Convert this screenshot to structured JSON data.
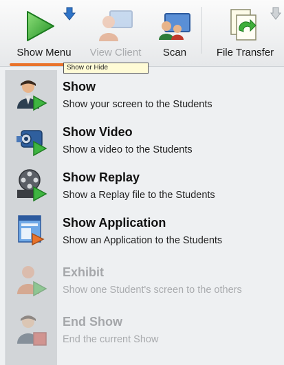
{
  "toolbar": {
    "buttons": [
      {
        "label": "Show Menu",
        "icon": "play-icon",
        "enabled": true,
        "active": true
      },
      {
        "label": "View Client",
        "icon": "view-client-icon",
        "enabled": false
      },
      {
        "label": "Scan",
        "icon": "scan-icon",
        "enabled": true
      },
      {
        "label": "File Transfer",
        "icon": "file-transfer-icon",
        "enabled": true
      }
    ],
    "tooltip": "Show or Hide"
  },
  "menu": {
    "items": [
      {
        "title": "Show",
        "description": "Show your screen to the Students",
        "icon": "show-screen-icon",
        "enabled": true
      },
      {
        "title": "Show Video",
        "description": "Show a video to the Students",
        "icon": "video-camera-icon",
        "enabled": true
      },
      {
        "title": "Show Replay",
        "description": "Show a Replay file to the Students",
        "icon": "film-reel-icon",
        "enabled": true
      },
      {
        "title": "Show Application",
        "description": "Show an Application to the Students",
        "icon": "application-window-icon",
        "enabled": true
      },
      {
        "title": "Exhibit",
        "description": "Show one Student's screen to the others",
        "icon": "exhibit-icon",
        "enabled": false
      },
      {
        "title": "End Show",
        "description": "End the current Show",
        "icon": "end-show-icon",
        "enabled": false
      }
    ]
  },
  "colors": {
    "accent": "#e9732b",
    "play_green": "#34b233",
    "arrow_blue": "#2f74c8",
    "disabled_text": "#a9abae"
  }
}
